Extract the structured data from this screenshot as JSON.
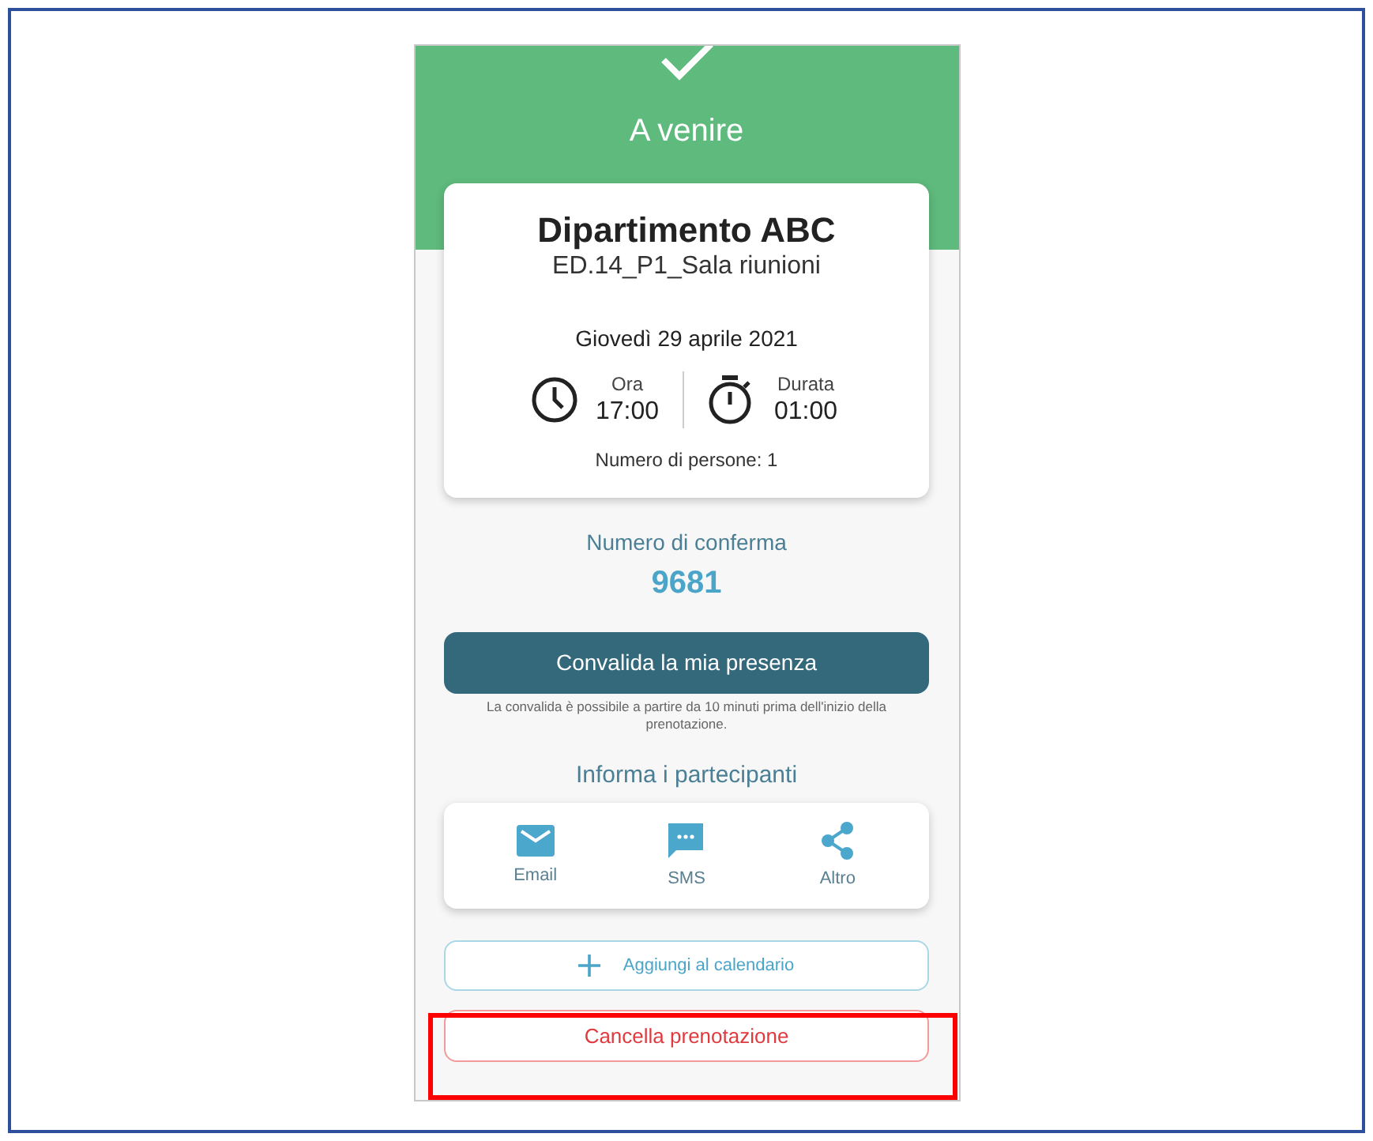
{
  "header": {
    "status": "A venire"
  },
  "booking": {
    "title": "Dipartimento ABC",
    "room": "ED.14_P1_Sala riunioni",
    "date": "Giovedì 29 aprile 2021",
    "time": {
      "label": "Ora",
      "value": "17:00"
    },
    "duration": {
      "label": "Durata",
      "value": "01:00"
    },
    "people": "Numero di persone: 1"
  },
  "confirmation": {
    "label": "Numero di conferma",
    "number": "9681"
  },
  "validate_button": "Convalida la mia presenza",
  "validate_note": "La convalida è possibile a partire da 10 minuti prima dell'inizio della prenotazione.",
  "share": {
    "title": "Informa i partecipanti",
    "options": [
      {
        "kind": "email",
        "label": "Email"
      },
      {
        "kind": "sms",
        "label": "SMS"
      },
      {
        "kind": "other",
        "label": "Altro"
      }
    ]
  },
  "calendar_button": "Aggiungi al calendario",
  "cancel_button": {
    "label": "Cancella prenotazione",
    "highlighted": true
  }
}
